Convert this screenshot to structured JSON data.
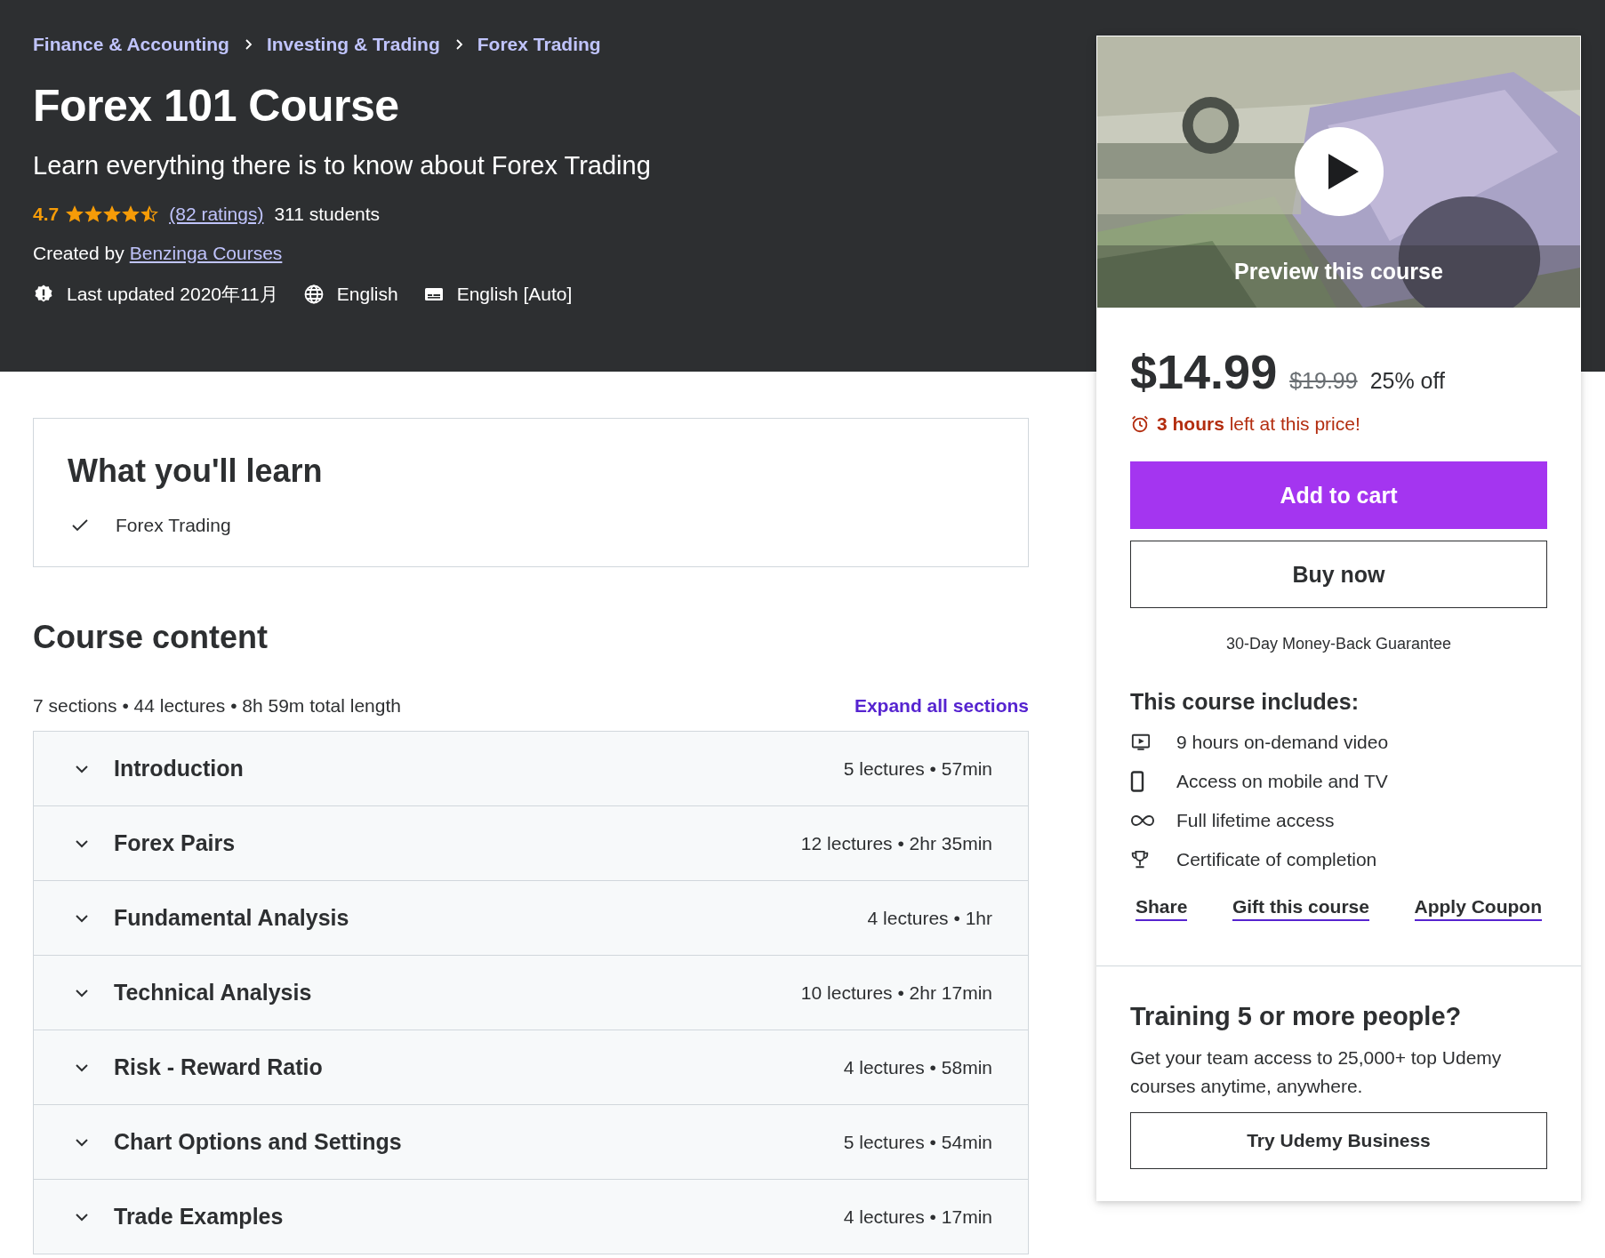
{
  "breadcrumbs": [
    "Finance & Accounting",
    "Investing & Trading",
    "Forex Trading"
  ],
  "title": "Forex 101 Course",
  "subtitle": "Learn everything there is to know about Forex Trading",
  "rating": {
    "value": "4.7",
    "stars": 4.5,
    "ratings_link": "(82 ratings)",
    "students": "311 students"
  },
  "created_by": {
    "label": "Created by",
    "author": "Benzinga Courses"
  },
  "meta": [
    {
      "kind": "updated",
      "text": "Last updated 2020年11月"
    },
    {
      "kind": "language",
      "text": "English"
    },
    {
      "kind": "captions",
      "text": "English [Auto]"
    }
  ],
  "learn": {
    "heading": "What you'll learn",
    "items": [
      "Forex Trading"
    ]
  },
  "course_content": {
    "heading": "Course content",
    "summary": "7 sections • 44 lectures • 8h 59m total length",
    "expand_link": "Expand all sections",
    "sections": [
      {
        "title": "Introduction",
        "info": "5 lectures • 57min",
        "expanded": false
      },
      {
        "title": "Forex Pairs",
        "info": "12 lectures • 2hr 35min",
        "expanded": false
      },
      {
        "title": "Fundamental Analysis",
        "info": "4 lectures • 1hr",
        "expanded": false
      },
      {
        "title": "Technical Analysis",
        "info": "10 lectures • 2hr 17min",
        "expanded": false
      },
      {
        "title": "Risk - Reward Ratio",
        "info": "4 lectures • 58min",
        "expanded": false
      },
      {
        "title": "Chart Options and Settings",
        "info": "5 lectures • 54min",
        "expanded": false
      },
      {
        "title": "Trade Examples",
        "info": "4 lectures • 17min",
        "expanded": false
      }
    ]
  },
  "sidebar": {
    "preview": {
      "kind": "picture",
      "label": "Preview this course"
    },
    "price": "$14.99",
    "original_price": "$19.99",
    "discount": "25% off",
    "countdown": "**3 hours** left at this price!",
    "add_to_cart": "Add to cart",
    "buy_now": "Buy now",
    "guarantee": "30-Day Money-Back Guarantee",
    "includes_heading": "This course includes:",
    "includes": [
      {
        "kind": "video",
        "text": "9 hours on-demand video"
      },
      {
        "kind": "mobile",
        "text": "Access on mobile and TV"
      },
      {
        "kind": "lifetime",
        "text": "Full lifetime access"
      },
      {
        "kind": "certificate",
        "text": "Certificate of completion"
      }
    ],
    "links": [
      "Share",
      "Gift this course",
      "Apply Coupon"
    ],
    "business": {
      "heading": "Training 5 or more people?",
      "text": "Get your team access to 25,000+ top Udemy courses anytime, anywhere.",
      "button": "Try Udemy Business"
    }
  }
}
